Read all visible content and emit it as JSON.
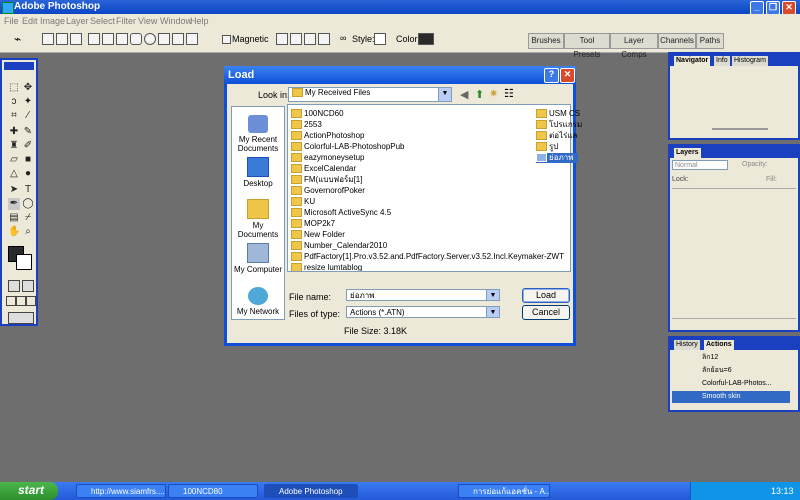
{
  "app": {
    "title": "Adobe Photoshop"
  },
  "menu": [
    "File",
    "Edit",
    "Image",
    "Layer",
    "Select",
    "Filter",
    "View",
    "Window",
    "Help"
  ],
  "options": {
    "magnetic_label": "Magnetic",
    "style_label": "Style:",
    "color_label": "Color:"
  },
  "palette_well": [
    "Brushes",
    "Tool Presets",
    "Layer Comps",
    "Channels",
    "Paths"
  ],
  "dialog": {
    "title": "Load",
    "look_in_label": "Look in:",
    "look_in_value": "My Received Files",
    "places": [
      "My Recent Documents",
      "Desktop",
      "My Documents",
      "My Computer",
      "My Network"
    ],
    "files_col1": [
      "100NCD60",
      "2553",
      "ActionPhotoshop",
      "Colorful-LAB-PhotoshopPub",
      "eazymoneysetup",
      "ExcelCalendar",
      "FM(แบบฟอร์ม[1]",
      "GovernorofPoker",
      "KU",
      "Microsoft ActiveSync 4.5",
      "MOP2k7",
      "New Folder",
      "Number_Calendar2010",
      "PdfFactory[1].Pro.v3.52.and.PdfFactory.Server.v3.52.Incl.Keymaker-ZWT",
      "resize lumtablog"
    ],
    "files_col2": [
      "USM CS",
      "โปรแกรม",
      "ต่อไร่แล",
      "รูป",
      "ย่อภาพ"
    ],
    "file_name_label": "File name:",
    "file_name_value": "ย่อภาพ",
    "file_type_label": "Files of type:",
    "file_type_value": "Actions (*.ATN)",
    "file_size": "File Size: 3.18K",
    "load_button": "Load",
    "cancel_button": "Cancel"
  },
  "navigator": {
    "tabs": [
      "Navigator",
      "Info",
      "Histogram"
    ]
  },
  "layers": {
    "tab": "Layers",
    "blend": "Normal",
    "opacity_label": "Opacity:",
    "lock_label": "Lock:",
    "fill_label": "Fill:"
  },
  "actions": {
    "tabs": [
      "History",
      "Actions"
    ],
    "items": [
      "ลิก12",
      "ลักย้อน=6",
      "Colorful-LAB-Photos...",
      "Smooth skin"
    ]
  },
  "taskbar": {
    "start": "start",
    "tasks": [
      "http://www.siamfrs....",
      "100NCD80",
      "Adobe Photoshop",
      "การย่อแก้แอคชั่น - A..."
    ],
    "clock": "13:13"
  },
  "colors": {
    "xp_blue": "#0d4fd9",
    "ps_blue": "#1a3fbf",
    "face": "#ece9d8"
  }
}
